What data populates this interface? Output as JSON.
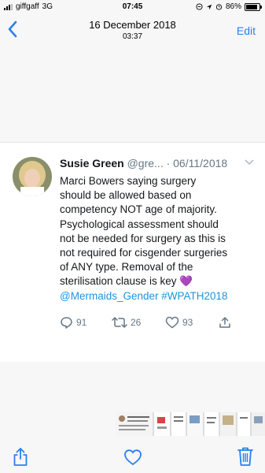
{
  "status": {
    "carrier": "giffgaff",
    "network": "3G",
    "time": "07:45",
    "battery": "86%",
    "battery_level": 0.86
  },
  "header": {
    "date": "16 December 2018",
    "time": "03:37",
    "edit_label": "Edit"
  },
  "tweet": {
    "name": "Susie Green",
    "handle_date": "@gre... · 06/11/2018",
    "lines": [
      "Marci Bowers saying surgery",
      "should be allowed based on",
      "competency NOT age of majority.",
      "Psychological assessment should",
      "not be needed for surgery as this is",
      "not required for cisgender surgeries",
      "of ANY type. Removal of the",
      "sterilisation clause is key"
    ],
    "emoji": "💜",
    "mention": "@Mermaids_Gender",
    "hashtag": "#WPATH2018",
    "replies": "91",
    "retweets": "26",
    "likes": "93"
  },
  "colors": {
    "link": "#1b95e0",
    "ios_blue": "#2b7ff0",
    "muted": "#657786"
  },
  "icons": [
    "back-chevron-icon",
    "location-icon",
    "alarm-icon",
    "reply-icon",
    "retweet-icon",
    "like-icon",
    "share-icon",
    "share-sheet-icon",
    "heart-outline-icon",
    "trash-icon"
  ]
}
